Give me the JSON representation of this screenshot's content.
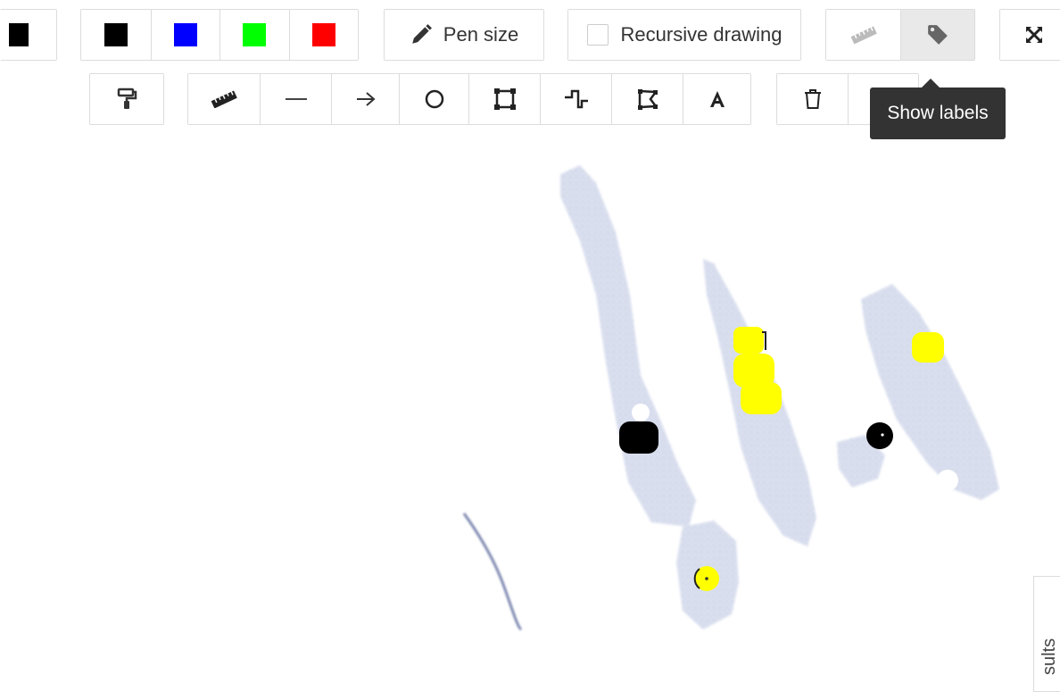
{
  "toolbar": {
    "colors": [
      {
        "name": "black",
        "hex": "#000000"
      },
      {
        "name": "blue",
        "hex": "#0000ff"
      },
      {
        "name": "green",
        "hex": "#00ff00"
      },
      {
        "name": "red",
        "hex": "#ff0000"
      }
    ],
    "partial_color": "#000000",
    "pen_size_label": "Pen size",
    "recursive_drawing_label": "Recursive drawing",
    "recursive_drawing_checked": false,
    "tools": [
      "paint-roller-icon",
      "ruler-icon",
      "line-icon",
      "arrow-icon",
      "circle-icon",
      "rectangle-icon",
      "freehand-icon",
      "polygon-icon",
      "text-icon"
    ],
    "delete_icons": [
      "trash-icon",
      "trash-filled-icon"
    ],
    "view_icons": [
      "ruler-toggle-icon",
      "tag-icon",
      "expand-icon"
    ]
  },
  "tooltip": {
    "text": "Show labels"
  },
  "annotation_colors": {
    "yellow": "#ffff00",
    "black": "#000000"
  },
  "side_tab": {
    "label": "sults"
  }
}
